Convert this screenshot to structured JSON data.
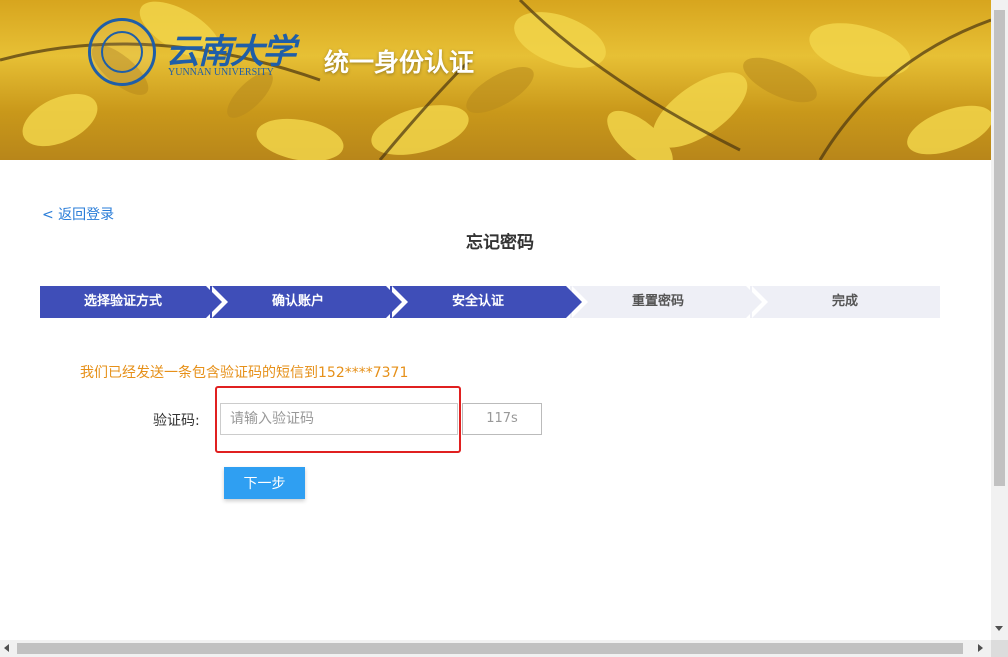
{
  "banner": {
    "university_name": "云南大学",
    "university_name_en": "YUNNAN UNIVERSITY",
    "seal_text": "YUNNAN UNIVERSITY",
    "title": "统一身份认证"
  },
  "nav": {
    "back_label": "< 返回登录"
  },
  "page": {
    "title": "忘记密码"
  },
  "steps": [
    {
      "label": "选择验证方式",
      "state": "done"
    },
    {
      "label": "确认账户",
      "state": "done"
    },
    {
      "label": "安全认证",
      "state": "current"
    },
    {
      "label": "重置密码",
      "state": "pending"
    },
    {
      "label": "完成",
      "state": "pending"
    }
  ],
  "verify": {
    "sent_message": "我们已经发送一条包含验证码的短信到152****7371",
    "code_label": "验证码:",
    "code_value": "",
    "code_placeholder": "请输入验证码",
    "countdown": "117s",
    "next_label": "下一步"
  },
  "colors": {
    "step_active": "#3f4eb8",
    "step_pending": "#eeeff6",
    "message": "#e69019",
    "link": "#2a7dd8",
    "primary_button": "#2f9ff2",
    "highlight": "#e02020"
  }
}
